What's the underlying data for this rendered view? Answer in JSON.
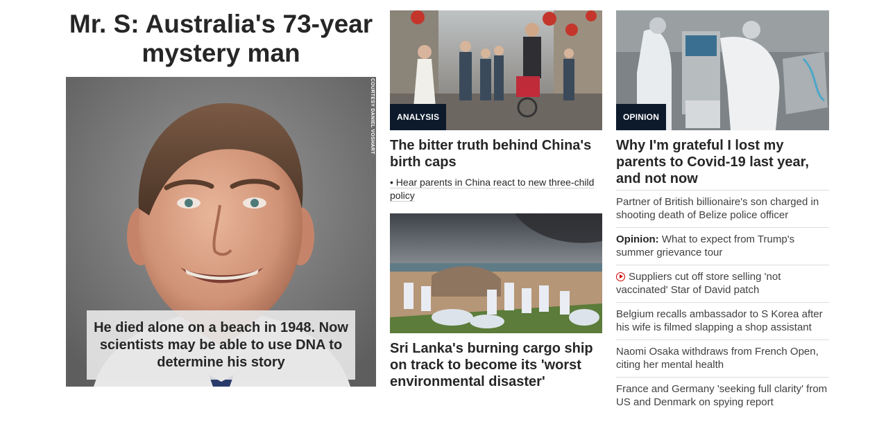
{
  "hero": {
    "title": "Mr. S: Australia's 73-year mystery man",
    "image_credit": "COURTESY DANIEL VOSHART",
    "caption": "He died alone on a beach in 1948. Now scientists may be able to use DNA to determine his story"
  },
  "middle": {
    "top_card": {
      "badge": "ANALYSIS",
      "headline": "The bitter truth behind China's birth caps",
      "sub_link": "• Hear parents in China react to new three-child policy"
    },
    "bottom_card": {
      "headline": "Sri Lanka's burning cargo ship on track to become its 'worst environmental disaster'"
    }
  },
  "right": {
    "top_card": {
      "badge": "OPINION",
      "headline": "Why I'm grateful I lost my parents to Covid-19 last year, and not now"
    },
    "headlines": [
      {
        "prefix": "",
        "text": "Partner of British billionaire's son charged in shooting death of Belize police officer",
        "icon": ""
      },
      {
        "prefix": "Opinion:",
        "text": " What to expect from Trump's summer grievance tour",
        "icon": ""
      },
      {
        "prefix": "",
        "text": "Suppliers cut off store selling 'not vaccinated' Star of David patch",
        "icon": "play-video-icon"
      },
      {
        "prefix": "",
        "text": "Belgium recalls ambassador to S Korea after his wife is filmed slapping a shop assistant",
        "icon": ""
      },
      {
        "prefix": "",
        "text": "Naomi Osaka withdraws from French Open, citing her mental health",
        "icon": ""
      },
      {
        "prefix": "",
        "text": "France and Germany 'seeking full clarity' from US and Denmark on spying report",
        "icon": ""
      }
    ]
  },
  "colors": {
    "badge_bg": "#0c1a2b",
    "video_icon": "#cc0000",
    "divider": "#dcdcdc"
  }
}
